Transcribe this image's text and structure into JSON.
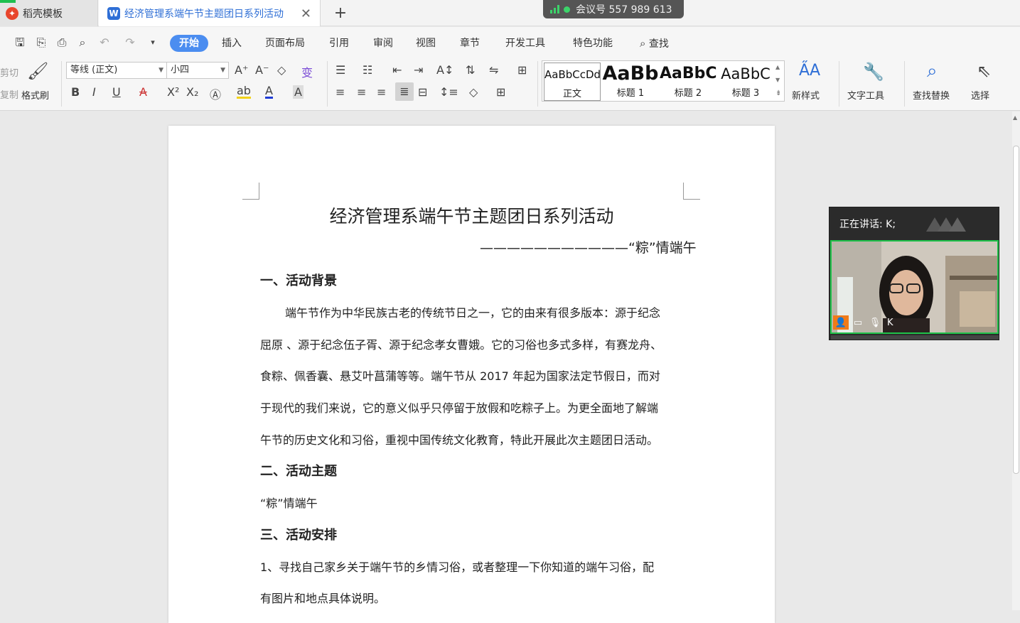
{
  "tabs": {
    "template_tab": {
      "label": "稻壳模板",
      "icon": "daoke-logo-icon"
    },
    "doc_tab": {
      "label": "经济管理系端午节主题团日系列活动",
      "icon": "wps-writer-icon"
    },
    "add_tab_symbol": "+"
  },
  "meeting_bar": {
    "text": "会议号 557 989 613"
  },
  "menu": {
    "items": [
      "开始",
      "插入",
      "页面布局",
      "引用",
      "审阅",
      "视图",
      "章节",
      "开发工具",
      "特色功能",
      "查找"
    ]
  },
  "ribbon": {
    "clipboard": {
      "cut": "剪切",
      "copy": "复制",
      "format_painter": "格式刷"
    },
    "font": {
      "font_name": "等线 (正文)",
      "font_size": "小四"
    },
    "styles": [
      {
        "sample": "AaBbCcDd",
        "label": "正文"
      },
      {
        "sample": "AaBb",
        "label": "标题 1"
      },
      {
        "sample": "AaBbC",
        "label": "标题 2"
      },
      {
        "sample": "AaBbC",
        "label": "标题 3"
      }
    ],
    "new_style": "新样式",
    "text_tools": "文字工具",
    "find_replace": "查找替换",
    "select": "选择"
  },
  "document": {
    "title": "经济管理系端午节主题团日系列活动",
    "subtitle": "———————————“粽”情端午",
    "h1": "一、活动背景",
    "p1_lines": [
      "端午节作为中华民族古老的传统节日之一，它的由来有很多版本：源于纪念",
      "屈原 、源于纪念伍子胥、源于纪念孝女曹娥。它的习俗也多式多样，有赛龙舟、",
      "食粽、佩香囊、悬艾叶菖蒲等等。端午节从 2017 年起为国家法定节假日，而对",
      "于现代的我们来说，它的意义似乎只停留于放假和吃粽子上。为更全面地了解端",
      "午节的历史文化和习俗，重视中国传统文化教育，特此开展此次主题团日活动。"
    ],
    "h2": "二、活动主题",
    "p2": "“粽”情端午",
    "h3": "三、活动安排",
    "p3_lines": [
      "1、寻找自己家乡关于端午节的乡情习俗，或者整理一下你知道的端午习俗，配",
      "有图片和地点具体说明。"
    ]
  },
  "video_panel": {
    "speaking": "正在讲话: K;",
    "participant_name": "K",
    "accent": "#1fc24a"
  }
}
